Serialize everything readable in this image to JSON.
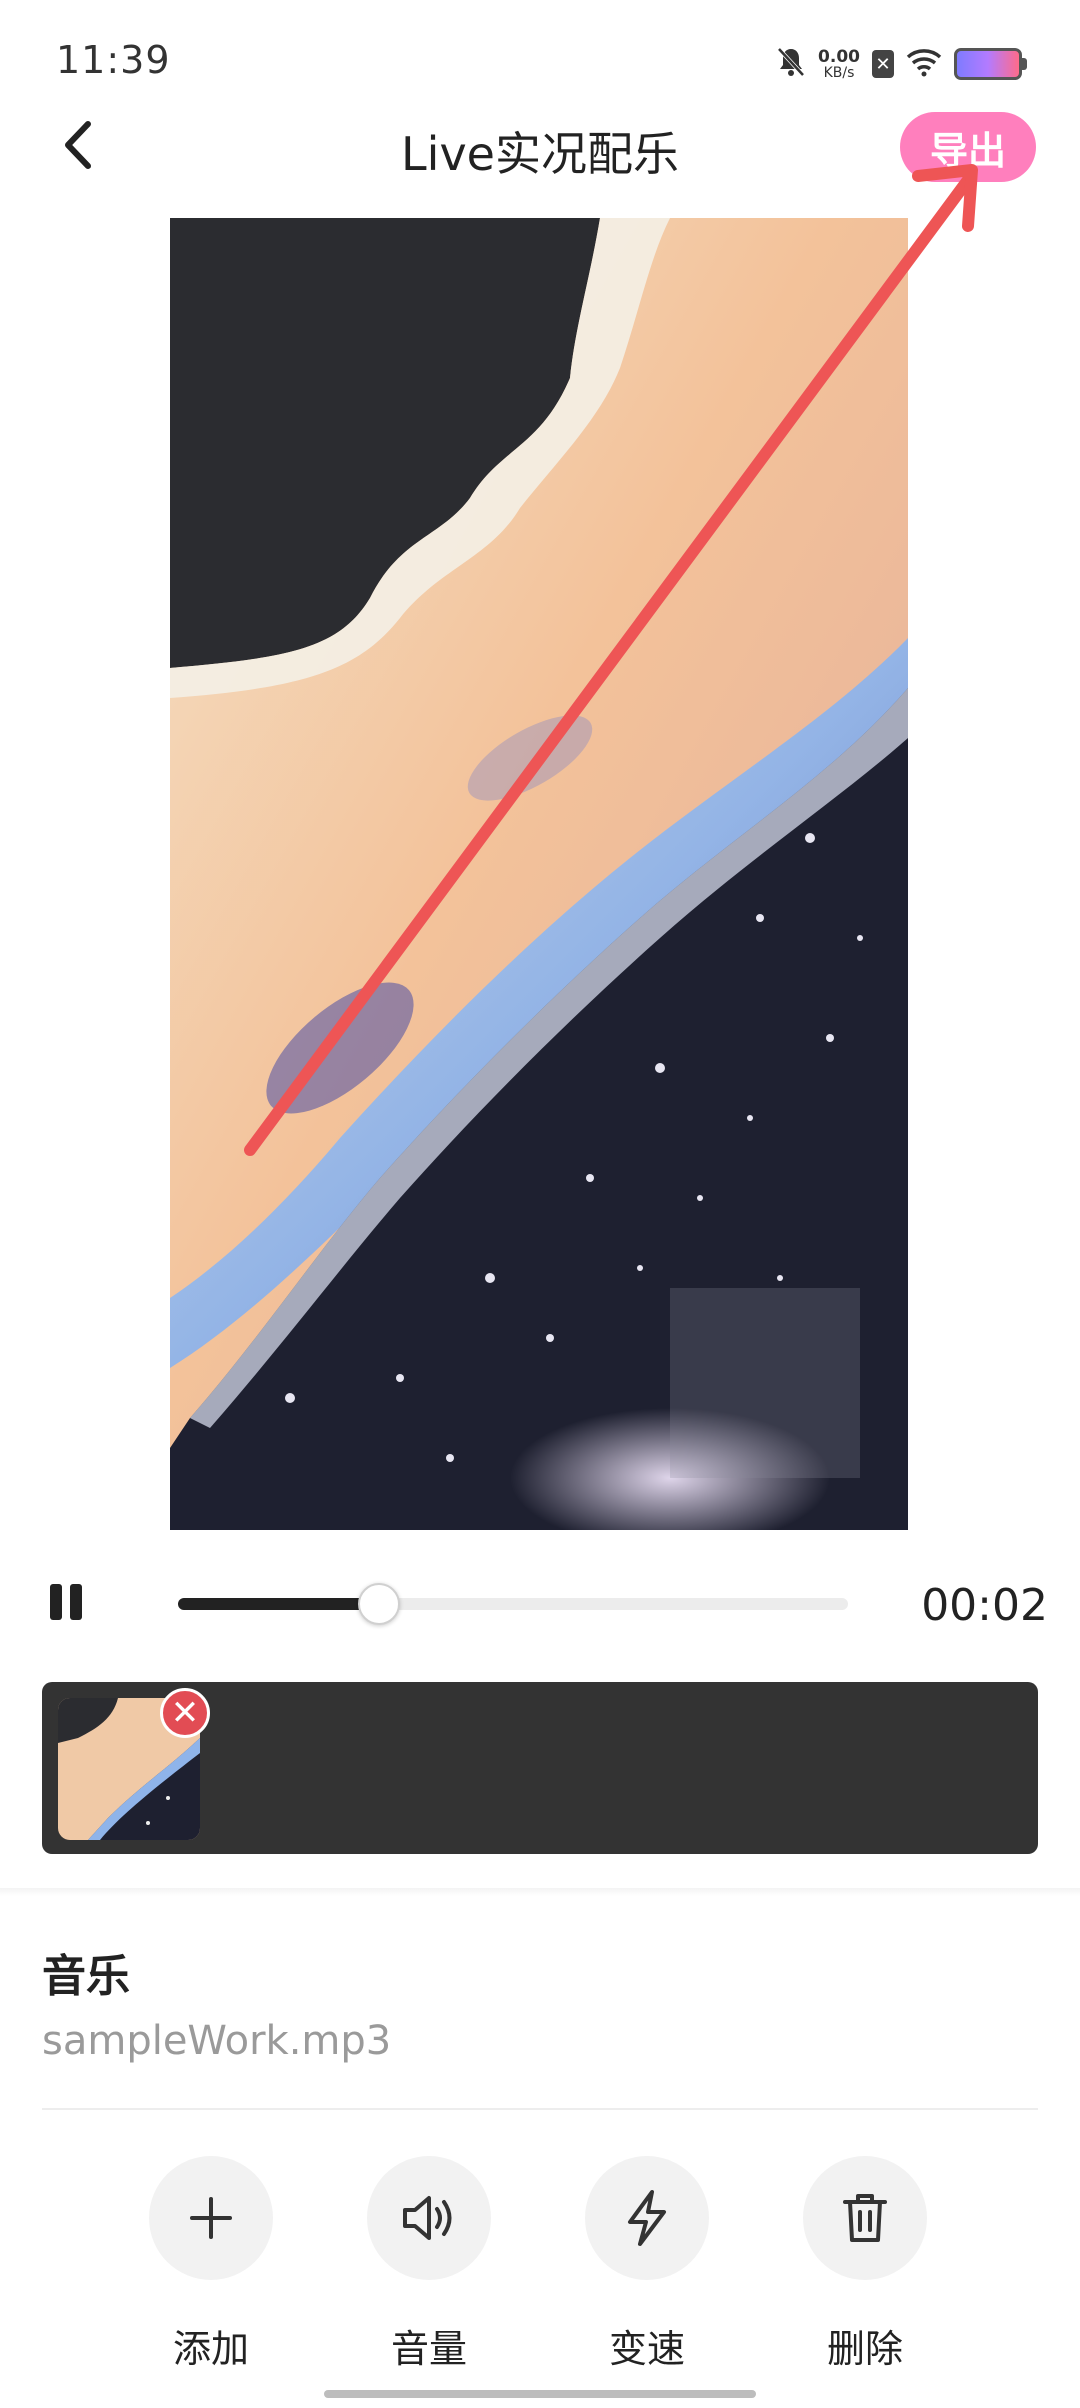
{
  "status_bar": {
    "time": "11:39",
    "net_speed_value": "0.00",
    "net_speed_unit": "KB/s",
    "icons": [
      "mute-bell-icon",
      "sim-x-icon",
      "wifi-icon",
      "battery-icon"
    ]
  },
  "header": {
    "title": "Live实况配乐",
    "export_label": "导出",
    "export_color": "#ff7fbd"
  },
  "player": {
    "time": "00:02",
    "progress_fraction": 0.3
  },
  "timeline": {
    "remove_glyph": "✕"
  },
  "music": {
    "section_title": "音乐",
    "file_name": "sampleWork.mp3"
  },
  "tools": [
    {
      "label": "添加",
      "icon": "plus-icon"
    },
    {
      "label": "音量",
      "icon": "speaker-icon"
    },
    {
      "label": "变速",
      "icon": "lightning-icon"
    },
    {
      "label": "删除",
      "icon": "trash-icon"
    }
  ],
  "annotation": {
    "color": "#ee5555"
  }
}
